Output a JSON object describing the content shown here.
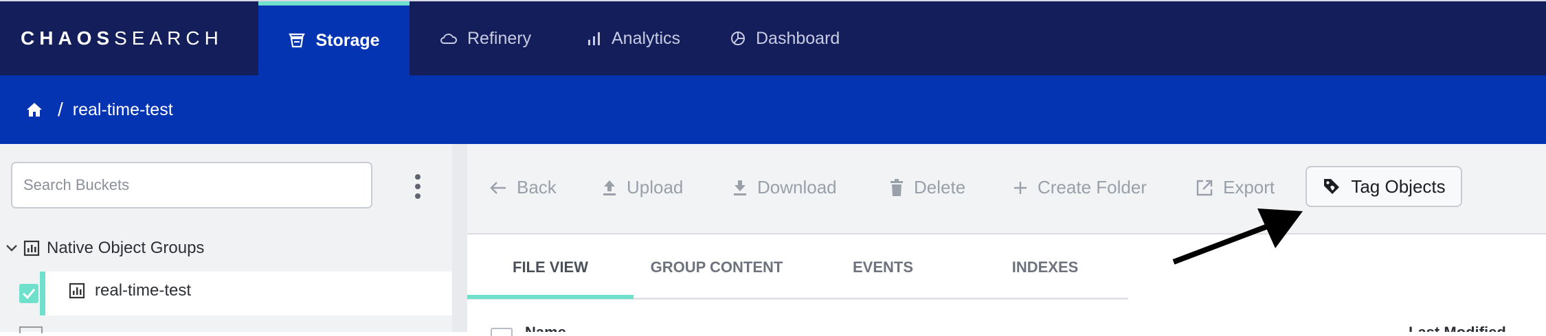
{
  "brand": {
    "logo_bold": "CHAOS",
    "logo_light": "SEARCH"
  },
  "nav": {
    "tabs": [
      {
        "label": "Storage",
        "icon": "storage-icon",
        "active": true
      },
      {
        "label": "Refinery",
        "icon": "cloud-icon",
        "active": false
      },
      {
        "label": "Analytics",
        "icon": "bar-chart-icon",
        "active": false
      },
      {
        "label": "Dashboard",
        "icon": "pie-chart-icon",
        "active": false
      }
    ]
  },
  "breadcrumb": {
    "separator": "/",
    "current": "real-time-test"
  },
  "sidebar": {
    "search_placeholder": "Search Buckets",
    "group_label": "Native Object Groups",
    "items": [
      {
        "label": "real-time-test",
        "checked": true
      }
    ]
  },
  "toolbar": {
    "back": "Back",
    "upload": "Upload",
    "download": "Download",
    "delete": "Delete",
    "create_folder": "Create Folder",
    "export": "Export",
    "tag_objects": "Tag Objects"
  },
  "content_tabs": [
    {
      "label": "FILE VIEW",
      "active": true
    },
    {
      "label": "GROUP CONTENT",
      "active": false
    },
    {
      "label": "EVENTS",
      "active": false
    },
    {
      "label": "INDEXES",
      "active": false
    }
  ],
  "table": {
    "col_name": "Name",
    "col_modified": "Last Modified"
  },
  "colors": {
    "nav_bg": "#141e5a",
    "accent_blue": "#0534b2",
    "accent_teal": "#6fe0cc"
  }
}
